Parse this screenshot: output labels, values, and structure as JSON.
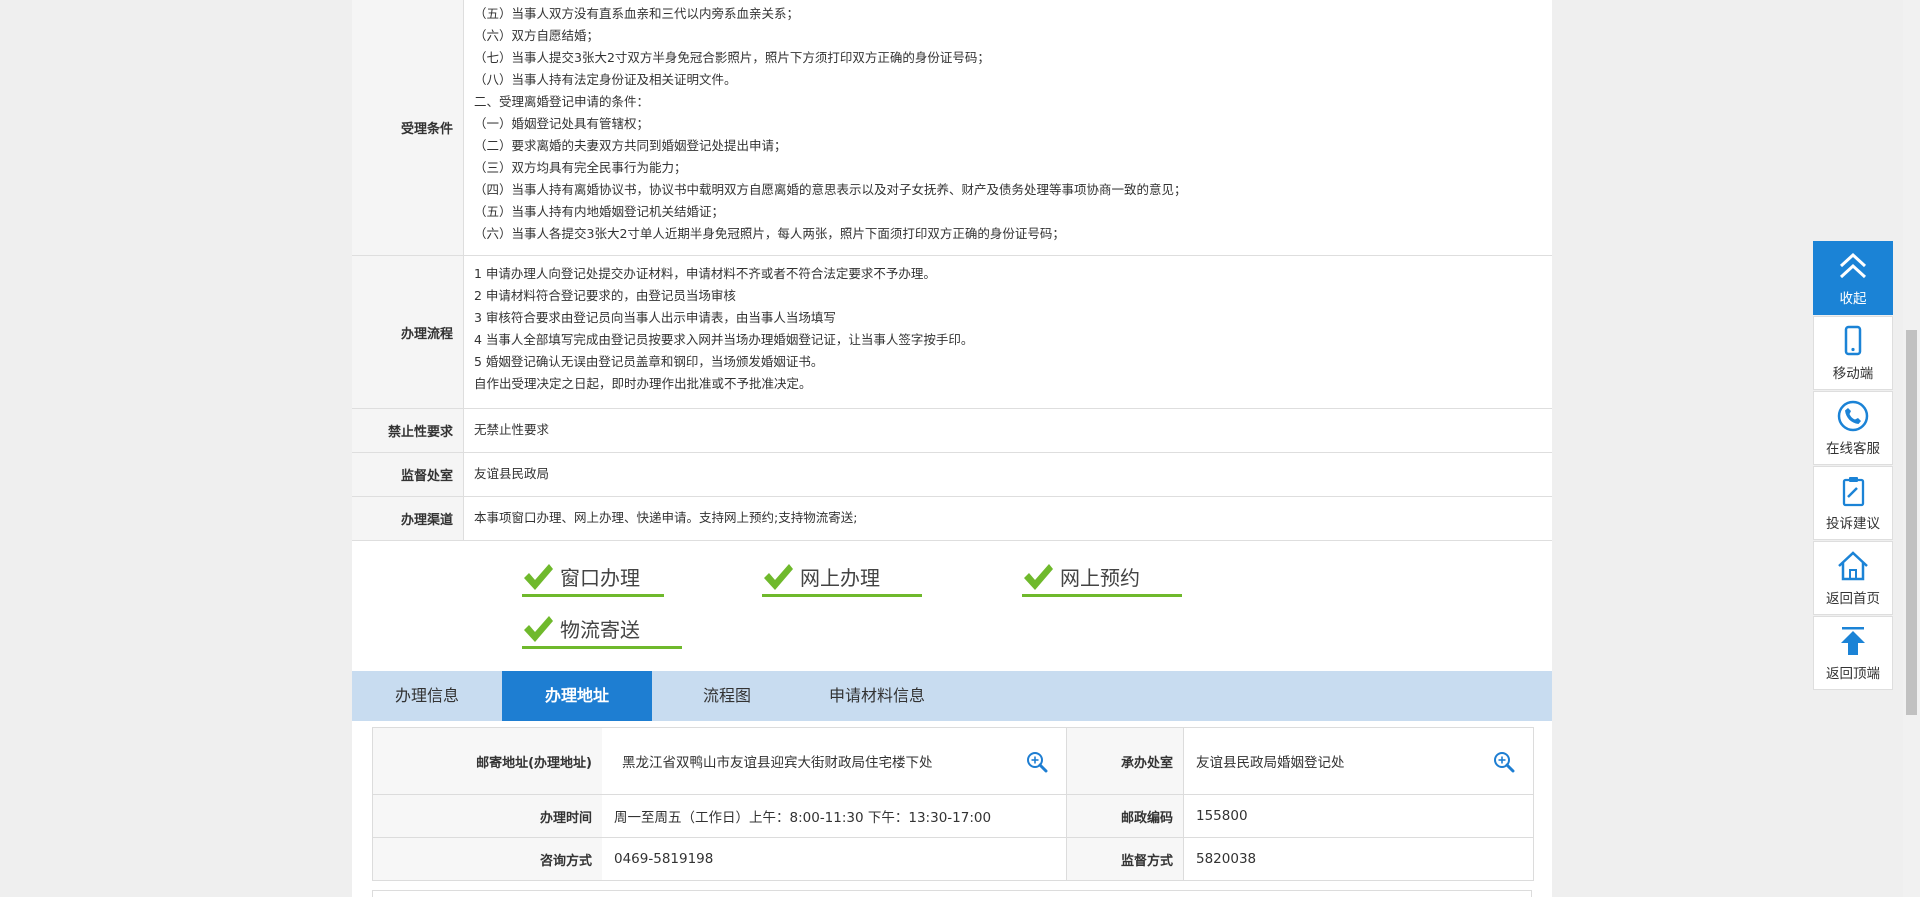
{
  "info_rows": {
    "conditions": {
      "label": "受理条件",
      "lines": [
        "（五）当事人双方没有直系血亲和三代以内旁系血亲关系；",
        "（六）双方自愿结婚；",
        "（七）当事人提交3张大2寸双方半身免冠合影照片，照片下方须打印双方正确的身份证号码；",
        "（八）当事人持有法定身份证及相关证明文件。",
        "二、受理离婚登记申请的条件：",
        "（一）婚姻登记处具有管辖权；",
        "（二）要求离婚的夫妻双方共同到婚姻登记处提出申请；",
        "（三）双方均具有完全民事行为能力；",
        "（四）当事人持有离婚协议书，协议书中载明双方自愿离婚的意思表示以及对子女抚养、财产及债务处理等事项协商一致的意见；",
        "（五）当事人持有内地婚姻登记机关结婚证；",
        "（六）当事人各提交3张大2寸单人近期半身免冠照片，每人两张，照片下面须打印双方正确的身份证号码；"
      ]
    },
    "process": {
      "label": "办理流程",
      "lines": [
        "1 申请办理人向登记处提交办证材料，申请材料不齐或者不符合法定要求不予办理。",
        "2 申请材料符合登记要求的，由登记员当场审核",
        "3 审核符合要求由登记员向当事人出示申请表，由当事人当场填写",
        "4 当事人全部填写完成由登记员按要求入网并当场办理婚姻登记证，让当事人签字按手印。",
        "5 婚姻登记确认无误由登记员盖章和钢印，当场颁发婚姻证书。",
        "自作出受理决定之日起，即时办理作出批准或不予批准决定。"
      ]
    },
    "prohibition": {
      "label": "禁止性要求",
      "value": "无禁止性要求"
    },
    "supervision": {
      "label": "监督处室",
      "value": "友谊县民政局"
    },
    "channel": {
      "label": "办理渠道",
      "value": "本事项窗口办理、网上办理、快递申请。支持网上预约;支持物流寄送;"
    }
  },
  "channels": [
    "窗口办理",
    "网上办理",
    "网上预约",
    "物流寄送"
  ],
  "tabs": [
    "办理信息",
    "办理地址",
    "流程图",
    "申请材料信息"
  ],
  "active_tab": "办理地址",
  "address": {
    "mail_label": "邮寄地址(办理地址)",
    "mail_value": "黑龙江省双鸭山市友谊县迎宾大街财政局住宅楼下处",
    "office_label": "承办处室",
    "office_value": "友谊县民政局婚姻登记处",
    "hours_label": "办理时间",
    "hours_value": "周一至周五（工作日）上午：8:00-11:30 下午：13:30-17:00",
    "postcode_label": "邮政编码",
    "postcode_value": "155800",
    "consult_label": "咨询方式",
    "consult_value": "0469-5819198",
    "supervise_label": "监督方式",
    "supervise_value": "5820038"
  },
  "sidebar": {
    "collapse": "收起",
    "mobile": "移动端",
    "service": "在线客服",
    "complaint": "投诉建议",
    "home": "返回首页",
    "top": "返回顶端"
  },
  "colors": {
    "accent": "#1e7ed2",
    "tab_bar": "#c8dcf0",
    "check_green": "#6fb92c"
  }
}
